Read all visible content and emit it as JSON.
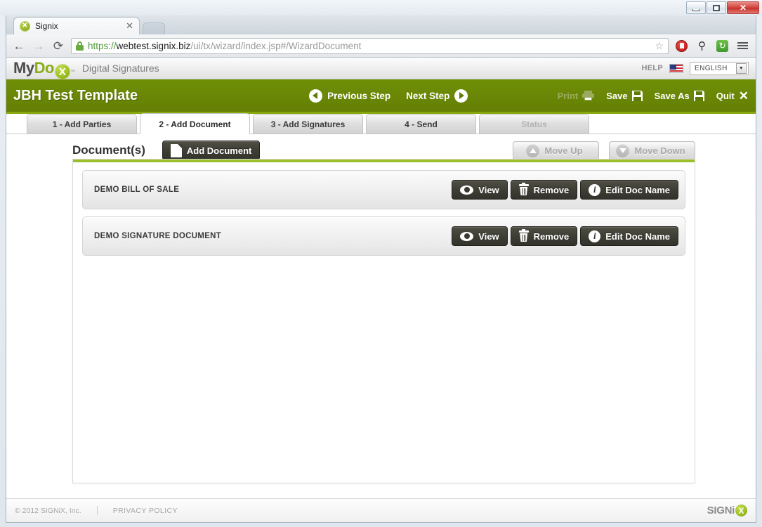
{
  "os": {
    "window_controls": {
      "minimize": "–",
      "maximize": "□",
      "close": "✕"
    }
  },
  "browser": {
    "tab": {
      "title": "Signix",
      "favicon": "signix-x-icon",
      "close_label": "✕"
    },
    "new_tab_label": "",
    "nav": {
      "back": "←",
      "forward": "→",
      "reload": "⟳"
    },
    "omnibox": {
      "lock_icon": "lock-icon",
      "scheme": "https://",
      "host": "webtest.signix.biz",
      "path": "/ui/tx/wizard/index.jsp#/WizardDocument",
      "full_url": "https://webtest.signix.biz/ui/tx/wizard/index.jsp#/WizardDocument",
      "star": "☆"
    },
    "extensions": [
      {
        "name": "adblock-icon"
      },
      {
        "name": "lastpass-icon"
      },
      {
        "name": "sync-icon"
      }
    ],
    "menu": "hamburger-menu-icon"
  },
  "app_header": {
    "brand": {
      "my": "My",
      "do": "Do",
      "x": "X",
      "tm": "™"
    },
    "subtitle": "Digital Signatures",
    "help_label": "HELP",
    "flag": "us-flag-icon",
    "language": {
      "value": "ENGLISH",
      "caret": "▼"
    }
  },
  "title_bar": {
    "document_title": "JBH Test Template",
    "previous_step": "Previous Step",
    "next_step": "Next Step",
    "actions": {
      "print": "Print",
      "save": "Save",
      "save_as": "Save As",
      "quit": "Quit"
    }
  },
  "wizard_tabs": [
    {
      "label": "1 - Add Parties",
      "state": "normal"
    },
    {
      "label": "2 - Add Document",
      "state": "active"
    },
    {
      "label": "3 - Add Signatures",
      "state": "normal"
    },
    {
      "label": "4 - Send",
      "state": "normal"
    },
    {
      "label": "Status",
      "state": "disabled"
    }
  ],
  "content": {
    "section_title": "Document(s)",
    "add_document_label": "Add Document",
    "move_up_label": "Move Up",
    "move_down_label": "Move Down",
    "row_actions": {
      "view": "View",
      "remove": "Remove",
      "edit_doc_name": "Edit Doc Name"
    },
    "documents": [
      {
        "name": "DEMO BILL OF SALE"
      },
      {
        "name": "DEMO SIGNATURE DOCUMENT"
      }
    ]
  },
  "footer": {
    "copyright": "© 2012 SIGNiX, Inc.",
    "privacy_policy": "PRIVACY POLICY",
    "logo": {
      "text": "SIGNi",
      "x": "X"
    }
  },
  "colors": {
    "brand_green": "#8aad1d",
    "title_bar_green": "#647f05",
    "rule_green": "#9dbe2b",
    "dark_button": "#3e3e35"
  }
}
